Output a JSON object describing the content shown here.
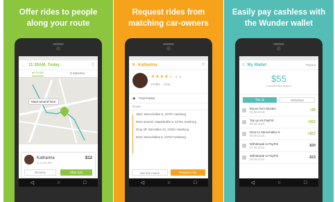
{
  "panels": [
    {
      "headline_line1": "Offer rides to people",
      "headline_line2": "along your route"
    },
    {
      "headline_line1": "Request rides from",
      "headline_line2": "matching car-owners"
    },
    {
      "headline_line1": "Easily pay cashless with",
      "headline_line2": "the Wunder wallet"
    }
  ],
  "screen1": {
    "title": "11:30AM, Today",
    "tab_route": "Route",
    "tab_matches": "Matches",
    "map_bubble": "Meet around here",
    "driver_name": "Katharina",
    "price": "$12",
    "time": "12:00 PM",
    "dismiss_label": "Dismiss",
    "offer_label": "Offer ride"
  },
  "screen2": {
    "title": "Katharina",
    "stars": "★★★★☆",
    "rating": "4.5",
    "actions": [
      "Profile",
      "Chat"
    ],
    "car": "Ford Fiesta",
    "route_title": "Route",
    "stops": [
      "Start: Sternchallee 8, 22767 Hamburg",
      "Meet around: Hauptstraße 8, 22761 Hamburg",
      "Drop off: Sternallee 23, 22301 Hamburg",
      "Dest: Sternchallee 8, 22767 Hamburg"
    ],
    "reject_label": "Not this match",
    "request_label": "Request ride"
  },
  "screen3": {
    "title": "My Wallet",
    "action": "Payout",
    "balance": "$55",
    "balance_note": "Includes $10 Bonus",
    "tab_topup": "Top up",
    "tab_withdraw": "Withdraw",
    "transactions": [
      {
        "label": "Bonus from Wunder",
        "date": "01.08.2016",
        "amount": "+$5"
      },
      {
        "label": "Top up via PayPal",
        "date": "05.08.2016",
        "amount": "+$15"
      },
      {
        "label": "Drive to Sternchallee 8",
        "date": "06.08.2016",
        "amount": "+$17"
      },
      {
        "label": "Withdrawal to PayPal",
        "date": "07.08.2016",
        "amount": "-$20"
      },
      {
        "label": "Withdrawal to PayPal",
        "date": "08.08.2016",
        "amount": "-$15"
      }
    ]
  },
  "colors": {
    "green": "#8cc63f",
    "orange": "#f7a21b",
    "teal": "#53bdb6"
  }
}
